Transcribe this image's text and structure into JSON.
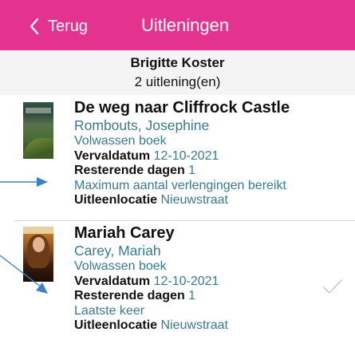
{
  "nav": {
    "back_label": "Terug",
    "title": "Uitleningen",
    "bar_color": "#e3338f"
  },
  "header": {
    "patron_name": "Brigitte Koster",
    "loan_count": "2 uitlening(en)"
  },
  "loans": [
    {
      "title": "De weg naar Cliffrock Castle",
      "author": "Rombouts,  Josephine",
      "category": "Volwassen boek",
      "due_label": "Vervaldatum",
      "due_date": "12-10-2021",
      "days_label": "Resterende dagen",
      "days_remaining": "1",
      "renewal_note": "Maximum aantal verlengingen bereikt",
      "location_label": "Uitleenlocatie",
      "location": "Nieuwstraat"
    },
    {
      "title": "Mariah Carey",
      "cover_text": "MARIAH CAREY",
      "author": "Carey,  Mariah",
      "category": "Volwassen boek",
      "due_label": "Vervaldatum",
      "due_date": "12-10-2021",
      "days_label": "Resterende dagen",
      "days_remaining": "1",
      "renewal_note": "Laatste keer",
      "location_label": "Uitleenlocatie",
      "location": "Nieuwstraat"
    }
  ],
  "colors": {
    "accent_text": "#3a7a8e",
    "annotation_arrow": "#3b82c4",
    "checkmark": "#c8c8cc"
  },
  "icons": [
    "chevron-left-icon",
    "checkmark-icon",
    "annotation-arrow"
  ]
}
